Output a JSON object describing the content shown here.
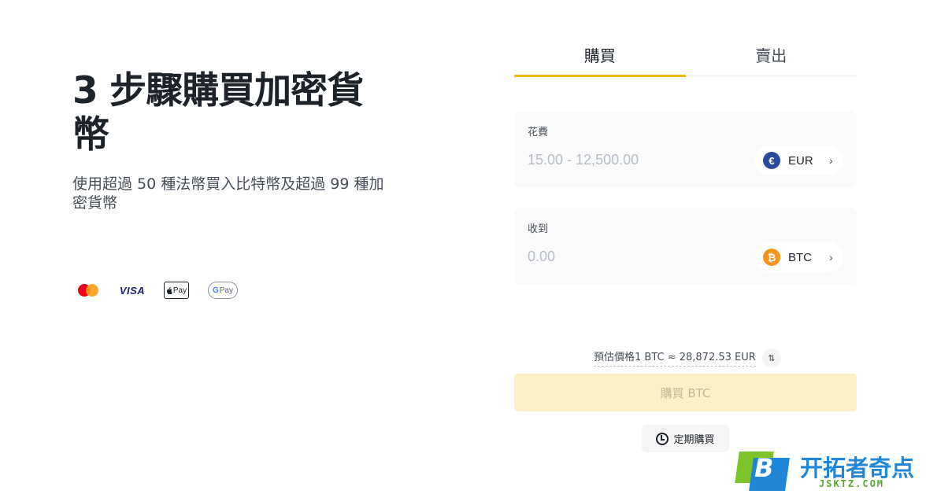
{
  "hero": {
    "title": "3 步驟購買加密貨幣",
    "subtitle": "使用超過 50 種法幣買入比特幣及超過 99 種加密貨幣"
  },
  "payments": {
    "visa_label": "VISA",
    "applepay_label": "Pay",
    "gpay_g": "G",
    "gpay_label": "Pay"
  },
  "tabs": [
    {
      "label": "購買",
      "active": true
    },
    {
      "label": "賣出",
      "active": false
    }
  ],
  "spend": {
    "label": "花費",
    "placeholder": "15.00 - 12,500.00",
    "currency": "EUR",
    "currency_symbol": "€",
    "icon": "euro-coin-icon"
  },
  "receive": {
    "label": "收到",
    "placeholder": "0.00",
    "currency": "BTC",
    "currency_symbol": "₿",
    "icon": "bitcoin-coin-icon"
  },
  "rate": {
    "text": "預估價格1 BTC ≈ 28,872.53 EUR"
  },
  "buy_button": {
    "label": "購買 BTC"
  },
  "recurring": {
    "label": "定期購買"
  },
  "watermark": {
    "letter": "B",
    "title": "开拓者奇点",
    "url": "JSKTZ.COM"
  },
  "colors": {
    "accent": "#f0b90b",
    "button_disabled": "#fcf0c4",
    "field_bg": "#fafafa",
    "text_primary": "#1e2329",
    "text_placeholder": "#b7bdc6"
  }
}
